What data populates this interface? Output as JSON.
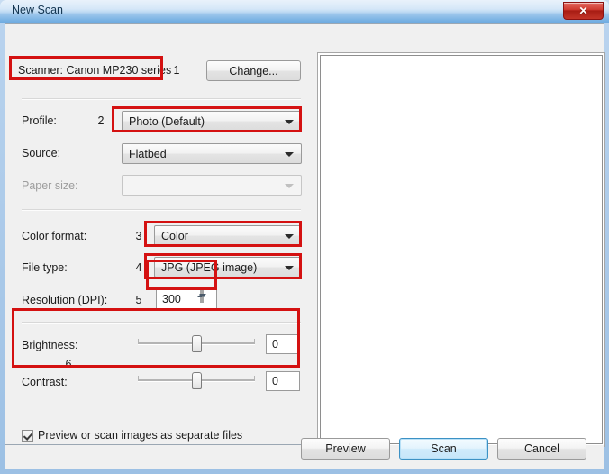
{
  "window": {
    "title": "New Scan",
    "close_label": "✕"
  },
  "scanner": {
    "label": "Scanner: Canon MP230 series",
    "marker": "1",
    "change_button": "Change..."
  },
  "fields": {
    "profile": {
      "label": "Profile:",
      "marker": "2",
      "value": "Photo (Default)"
    },
    "source": {
      "label": "Source:",
      "value": "Flatbed"
    },
    "paper_size": {
      "label": "Paper size:",
      "value": ""
    },
    "color_format": {
      "label": "Color format:",
      "marker": "3",
      "value": "Color"
    },
    "file_type": {
      "label": "File type:",
      "marker": "4",
      "value": "JPG (JPEG image)"
    },
    "resolution": {
      "label": "Resolution (DPI):",
      "marker": "5",
      "value": "300"
    }
  },
  "adjust": {
    "marker": "6",
    "brightness": {
      "label": "Brightness:",
      "value": "0",
      "percent": 50
    },
    "contrast": {
      "label": "Contrast:",
      "value": "0",
      "percent": 50
    }
  },
  "checkbox": {
    "label": "Preview or scan images as separate files",
    "checked": true
  },
  "buttons": {
    "preview": "Preview",
    "scan": "Scan",
    "cancel": "Cancel"
  },
  "colors": {
    "annotation": "#d41111",
    "titlebar_text": "#11334f",
    "default_button_border": "#3c91c4"
  }
}
